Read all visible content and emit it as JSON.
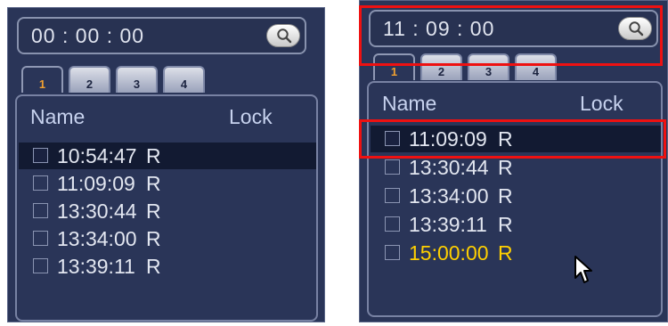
{
  "left_panel": {
    "time": "00 : 00 : 00",
    "tabs": [
      "1",
      "2",
      "3",
      "4"
    ],
    "active_tab": 0,
    "header": {
      "name": "Name",
      "lock": "Lock"
    },
    "rows": [
      {
        "time": "10:54:47",
        "lock": "R",
        "selected": true
      },
      {
        "time": "11:09:09",
        "lock": "R"
      },
      {
        "time": "13:30:44",
        "lock": "R"
      },
      {
        "time": "13:34:00",
        "lock": "R"
      },
      {
        "time": "13:39:11",
        "lock": "R"
      }
    ]
  },
  "right_panel": {
    "time": "11 : 09 : 00",
    "tabs": [
      "1",
      "2",
      "3",
      "4"
    ],
    "active_tab": 0,
    "header": {
      "name": "Name",
      "lock": "Lock"
    },
    "rows": [
      {
        "time": "11:09:09",
        "lock": "R",
        "selected": true
      },
      {
        "time": "13:30:44",
        "lock": "R"
      },
      {
        "time": "13:34:00",
        "lock": "R"
      },
      {
        "time": "13:39:11",
        "lock": "R"
      },
      {
        "time": "15:00:00",
        "lock": "R",
        "highlight": true
      }
    ]
  },
  "icons": {
    "search": "search-icon",
    "cursor": "mouse-pointer-icon"
  },
  "colors": {
    "panel_bg": "#2a3558",
    "selected_row": "#121a32",
    "active_tab_number": "#f0a030",
    "highlight_text": "#ffd000",
    "annotation_red": "#ee1111"
  }
}
